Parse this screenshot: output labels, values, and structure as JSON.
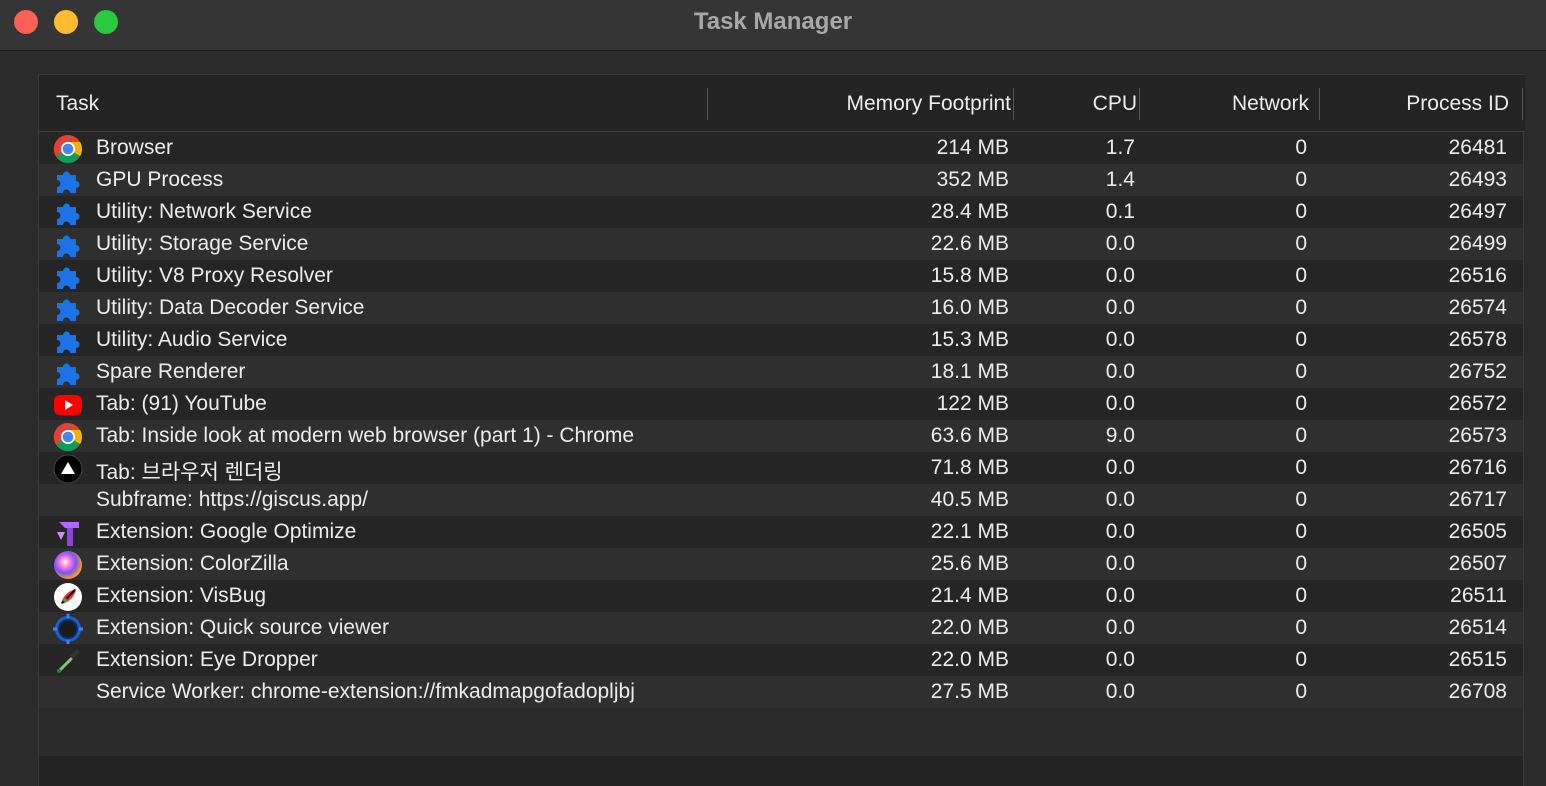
{
  "window": {
    "title": "Task Manager"
  },
  "columns": {
    "task": "Task",
    "memory": "Memory Footprint",
    "cpu": "CPU",
    "network": "Network",
    "pid": "Process ID"
  },
  "rows": [
    {
      "icon": "chrome-icon",
      "task": "Browser",
      "memory": "214 MB",
      "cpu": "1.7",
      "network": "0",
      "pid": "26481"
    },
    {
      "icon": "puzzle-icon",
      "task": "GPU Process",
      "memory": "352 MB",
      "cpu": "1.4",
      "network": "0",
      "pid": "26493"
    },
    {
      "icon": "puzzle-icon",
      "task": "Utility: Network Service",
      "memory": "28.4 MB",
      "cpu": "0.1",
      "network": "0",
      "pid": "26497"
    },
    {
      "icon": "puzzle-icon",
      "task": "Utility: Storage Service",
      "memory": "22.6 MB",
      "cpu": "0.0",
      "network": "0",
      "pid": "26499"
    },
    {
      "icon": "puzzle-icon",
      "task": "Utility: V8 Proxy Resolver",
      "memory": "15.8 MB",
      "cpu": "0.0",
      "network": "0",
      "pid": "26516"
    },
    {
      "icon": "puzzle-icon",
      "task": "Utility: Data Decoder Service",
      "memory": "16.0 MB",
      "cpu": "0.0",
      "network": "0",
      "pid": "26574"
    },
    {
      "icon": "puzzle-icon",
      "task": "Utility: Audio Service",
      "memory": "15.3 MB",
      "cpu": "0.0",
      "network": "0",
      "pid": "26578"
    },
    {
      "icon": "puzzle-icon",
      "task": "Spare Renderer",
      "memory": "18.1 MB",
      "cpu": "0.0",
      "network": "0",
      "pid": "26752"
    },
    {
      "icon": "youtube-icon",
      "task": "Tab: (91) YouTube",
      "memory": "122 MB",
      "cpu": "0.0",
      "network": "0",
      "pid": "26572"
    },
    {
      "icon": "chrome-icon",
      "task": "Tab: Inside look at modern web browser (part 1) - Chrome",
      "memory": "63.6 MB",
      "cpu": "9.0",
      "network": "0",
      "pid": "26573"
    },
    {
      "icon": "triangle-icon",
      "task": "Tab: 브라우저 렌더링",
      "memory": "71.8 MB",
      "cpu": "0.0",
      "network": "0",
      "pid": "26716"
    },
    {
      "icon": "none",
      "task": "Subframe: https://giscus.app/",
      "memory": "40.5 MB",
      "cpu": "0.0",
      "network": "0",
      "pid": "26717"
    },
    {
      "icon": "optimize-icon",
      "task": "Extension: Google Optimize",
      "memory": "22.1 MB",
      "cpu": "0.0",
      "network": "0",
      "pid": "26505"
    },
    {
      "icon": "colorzilla-icon",
      "task": "Extension: ColorZilla",
      "memory": "25.6 MB",
      "cpu": "0.0",
      "network": "0",
      "pid": "26507"
    },
    {
      "icon": "visbug-icon",
      "task": "Extension: VisBug",
      "memory": "21.4 MB",
      "cpu": "0.0",
      "network": "0",
      "pid": "26511"
    },
    {
      "icon": "gear-icon",
      "task": "Extension: Quick source viewer",
      "memory": "22.0 MB",
      "cpu": "0.0",
      "network": "0",
      "pid": "26514"
    },
    {
      "icon": "eyedropper-icon",
      "task": "Extension: Eye Dropper",
      "memory": "22.0 MB",
      "cpu": "0.0",
      "network": "0",
      "pid": "26515"
    },
    {
      "icon": "none",
      "task": "Service Worker: chrome-extension://fmkadmapgofadopljbj",
      "memory": "27.5 MB",
      "cpu": "0.0",
      "network": "0",
      "pid": "26708"
    }
  ]
}
